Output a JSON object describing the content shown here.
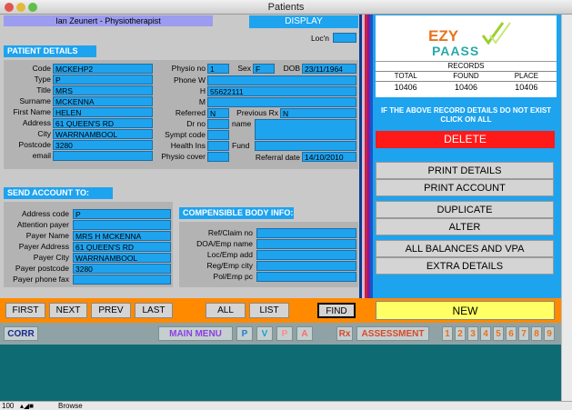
{
  "window": {
    "title": "Patients"
  },
  "header": {
    "practitioner": "Ian Zeunert - Physiotherapist",
    "display_label": "DISPLAY",
    "locn_label": "Loc'n"
  },
  "patient_details": {
    "heading": "PATIENT DETAILS",
    "code_label": "Code",
    "code": "MCKEHP2",
    "type_label": "Type",
    "type": "P",
    "title_label": "Title",
    "title": "MRS",
    "surname_label": "Surname",
    "surname": "MCKENNA",
    "first_name_label": "First Name",
    "first_name": "HELEN",
    "address_label": "Address",
    "address": "61 QUEEN'S RD",
    "city_label": "City",
    "city": "WARRNAMBOOL",
    "postcode_label": "Postcode",
    "postcode": "3280",
    "email_label": "email",
    "email": "",
    "physio_no_label": "Physio no",
    "physio_no": "1",
    "sex_label": "Sex",
    "sex": "F",
    "dob_label": "DOB",
    "dob": "23/11/1964",
    "phone_w_label": "Phone W",
    "phone_w": "",
    "phone_h_label": "H",
    "phone_h": "55622111",
    "phone_m_label": "M",
    "phone_m": "",
    "referred_label": "Referred",
    "referred": "N",
    "previous_rx_label": "Previous Rx",
    "previous_rx": "N",
    "dr_no_label": "Dr no",
    "dr_no": "",
    "name_label": "name",
    "sympt_code_label": "Sympt code",
    "health_ins_label": "Health Ins",
    "fund_label": "Fund",
    "physio_cover_label": "Physio cover",
    "referral_date_label": "Referral date",
    "referral_date": "14/10/2010"
  },
  "send_account": {
    "heading": "SEND ACCOUNT TO:",
    "address_code_label": "Address code",
    "address_code": "P",
    "attention_payer_label": "Attention payer",
    "attention_payer": "",
    "payer_name_label": "Payer Name",
    "payer_name": "MRS H MCKENNA",
    "payer_address_label": "Payer Address",
    "payer_address": "61 QUEEN'S RD",
    "payer_city_label": "Payer City",
    "payer_city": "WARRNAMBOOL",
    "payer_postcode_label": "Payer postcode",
    "payer_postcode": "3280",
    "payer_phone_fax_label": "Payer phone fax",
    "payer_phone_fax": ""
  },
  "compensible": {
    "heading": "COMPENSIBLE BODY INFO:",
    "ref_claim_label": "Ref/Claim no",
    "doa_emp_label": "DOA/Emp name",
    "loc_emp_label": "Loc/Emp add",
    "reg_emp_label": "Reg/Emp city",
    "pol_emp_label": "Pol/Emp pc"
  },
  "logo": {
    "text_top": "EZY",
    "text_bottom": "PAASS"
  },
  "records": {
    "heading": "RECORDS",
    "columns": [
      "TOTAL",
      "FOUND",
      "PLACE"
    ],
    "values": [
      "10406",
      "10406",
      "10406"
    ]
  },
  "right_panel": {
    "notice": "IF THE ABOVE RECORD DETAILS DO NOT EXIST CLICK ON  ALL",
    "delete": "DELETE",
    "print_details": "PRINT DETAILS",
    "print_account": "PRINT ACCOUNT",
    "duplicate": "DUPLICATE",
    "alter": "ALTER",
    "all_balances": "ALL BALANCES AND VPA",
    "extra_details": "EXTRA DETAILS"
  },
  "nav": {
    "first": "FIRST",
    "next": "NEXT",
    "prev": "PREV",
    "last": "LAST",
    "all": "ALL",
    "list": "LIST",
    "find": "FIND",
    "new": "NEW"
  },
  "bottom": {
    "corr": "CORR",
    "main_menu": "MAIN MENU",
    "p": "P",
    "v": "V",
    "p2": "P",
    "a": "A",
    "rx": "Rx",
    "assessment": "ASSESSMENT",
    "numbers": [
      "1",
      "2",
      "3",
      "4",
      "5",
      "6",
      "7",
      "8",
      "9"
    ]
  },
  "status": {
    "zoom": "100",
    "mode": "Browse"
  },
  "colors": {
    "field_blue": "#1ea3ef",
    "nav_orange": "#ff8a00",
    "delete_red": "#ff1a1a",
    "new_yellow": "#ffff66",
    "teal": "#0f6b73"
  }
}
